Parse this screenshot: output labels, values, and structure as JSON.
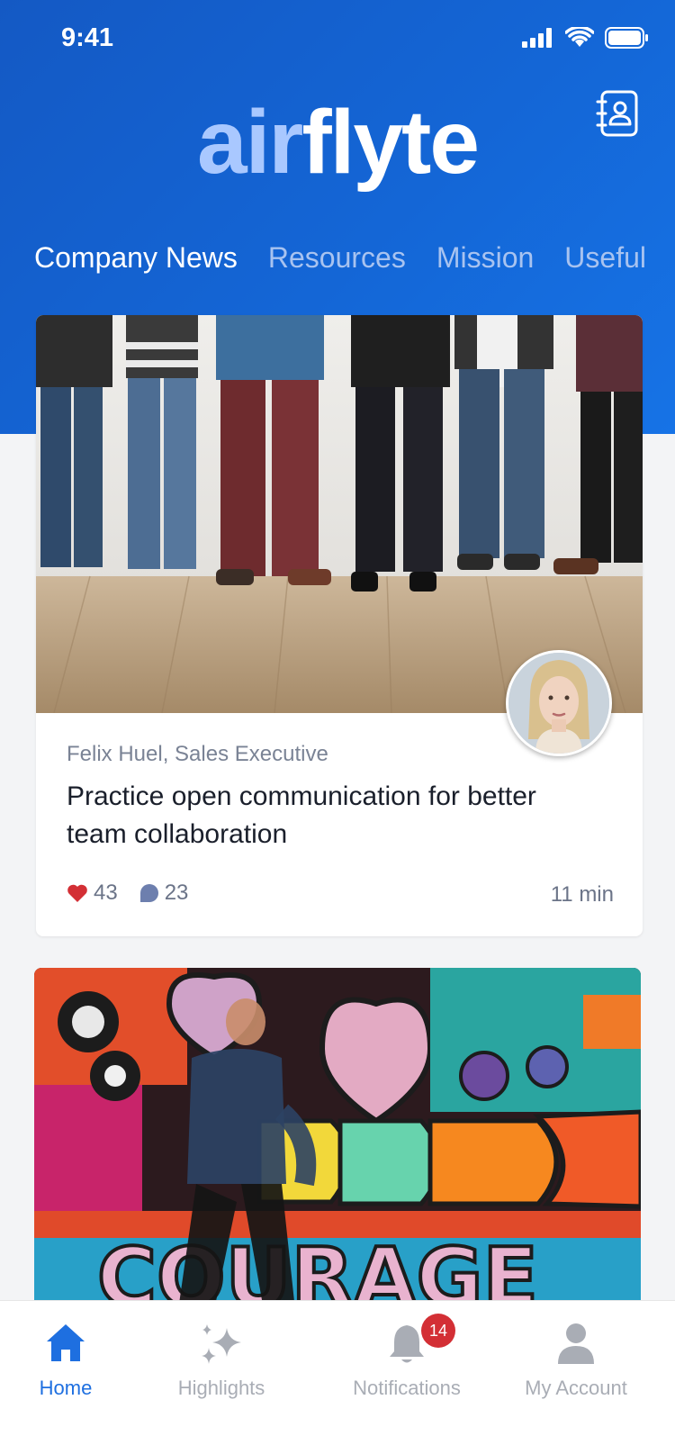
{
  "status": {
    "time": "9:41"
  },
  "app": {
    "logo_part1": "air",
    "logo_part2": "flyte"
  },
  "tabs": [
    {
      "label": "Company News",
      "active": true
    },
    {
      "label": "Resources",
      "active": false
    },
    {
      "label": "Mission",
      "active": false
    },
    {
      "label": "Useful",
      "active": false
    }
  ],
  "article": {
    "author": "Felix Huel, Sales Executive",
    "title": "Practice open communication for better team collaboration",
    "likes": "43",
    "comments": "23",
    "read_time": "11 min"
  },
  "bottom_nav": {
    "items": [
      {
        "label": "Home",
        "icon": "home-icon",
        "active": true
      },
      {
        "label": "Highlights",
        "icon": "sparkle-icon"
      },
      {
        "label": "Notifications",
        "icon": "bell-icon",
        "badge": "14"
      },
      {
        "label": "My Account",
        "icon": "user-icon"
      }
    ]
  },
  "colors": {
    "primary": "#1466d6",
    "like": "#d32f35",
    "badge": "#d32f35"
  }
}
